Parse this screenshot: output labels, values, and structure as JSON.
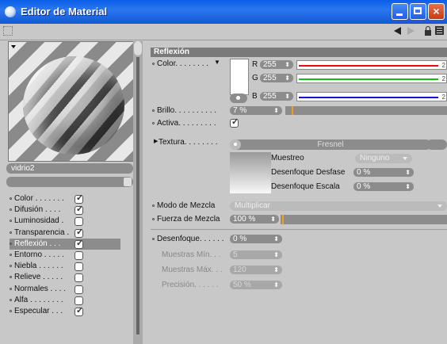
{
  "window": {
    "title": "Editor de Material"
  },
  "colors": {
    "titlebar": "#1656d6",
    "close": "#c83a12",
    "red": "#e01010",
    "green": "#10c010",
    "blue": "#1010d0",
    "accent": "#f0a020"
  },
  "preview": {
    "material_name": "vidrio2"
  },
  "channels": [
    {
      "label": "Color",
      "checked": true
    },
    {
      "label": "Difusión",
      "checked": true
    },
    {
      "label": "Luminosidad",
      "checked": false
    },
    {
      "label": "Transparencia",
      "checked": true
    },
    {
      "label": "Reflexión",
      "checked": true,
      "selected": true
    },
    {
      "label": "Entorno",
      "checked": false
    },
    {
      "label": "Niebla",
      "checked": false
    },
    {
      "label": "Relieve",
      "checked": false
    },
    {
      "label": "Normales",
      "checked": false
    },
    {
      "label": "Alfa",
      "checked": false
    },
    {
      "label": "Especular",
      "checked": true
    }
  ],
  "reflection": {
    "header": "Reflexión",
    "color_label": "Color",
    "r_label": "R",
    "r_value": "255",
    "g_label": "G",
    "g_value": "255",
    "b_label": "B",
    "b_value": "255",
    "r_end": "2",
    "g_end": "2",
    "b_end": "2",
    "brillo_label": "Brillo",
    "brillo_value": "7 %",
    "brillo_level": 0.07,
    "activa_label": "Activa",
    "activa_checked": true,
    "textura_label": "Textura",
    "textura_value": "Fresnel",
    "muestreo_label": "Muestreo",
    "muestreo_value": "Ninguno",
    "desenfoque_desfase_label": "Desenfoque Desfase",
    "desenfoque_desfase_value": "0 %",
    "desenfoque_escala_label": "Desenfoque Escala",
    "desenfoque_escala_value": "0 %",
    "modo_mezcla_label": "Modo de Mezcla",
    "modo_mezcla_value": "Multiplicar",
    "fuerza_mezcla_label": "Fuerza de Mezcla",
    "fuerza_mezcla_value": "100 %",
    "desenfoque_label": "Desenfoque",
    "desenfoque_value": "0 %",
    "muestras_min_label": "Muestras Mín",
    "muestras_min_value": "5",
    "muestras_max_label": "Muestras Máx",
    "muestras_max_value": "120",
    "precision_label": "Precisión",
    "precision_value": "50 %"
  }
}
